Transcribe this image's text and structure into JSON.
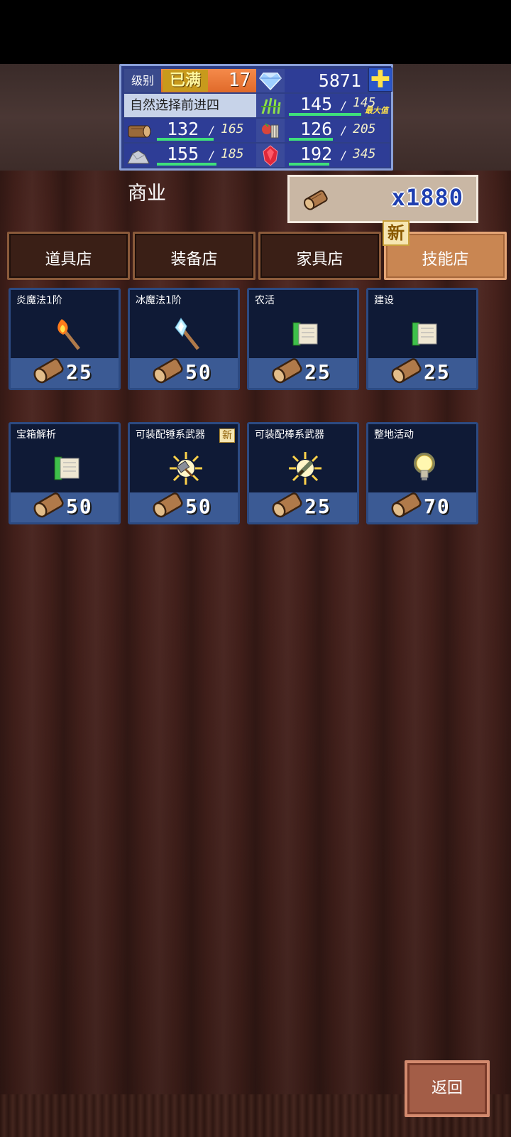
{
  "hud": {
    "level_label": "级别",
    "level_max": "已满",
    "level": "17",
    "gems": "5871",
    "title": "自然选择前进四",
    "plus_icon": "plus-icon",
    "grass": {
      "value": "145",
      "max": "145",
      "note": "最大值",
      "fill": 1.0
    },
    "wood": {
      "value": "132",
      "max": "165",
      "fill": 0.8
    },
    "food": {
      "value": "126",
      "max": "205",
      "fill": 0.61
    },
    "ore": {
      "value": "155",
      "max": "185",
      "fill": 0.84
    },
    "ruby": {
      "value": "192",
      "max": "345",
      "fill": 0.56
    }
  },
  "header": {
    "title": "商业",
    "currency": "x1880",
    "new_badge": "新"
  },
  "tabs": [
    {
      "label": "道具店",
      "active": false
    },
    {
      "label": "装备店",
      "active": false
    },
    {
      "label": "家具店",
      "active": false
    },
    {
      "label": "技能店",
      "active": true
    }
  ],
  "skills": [
    {
      "name": "炎魔法1阶",
      "icon": "fire-staff-icon",
      "price": "25"
    },
    {
      "name": "冰魔法1阶",
      "icon": "ice-staff-icon",
      "price": "50"
    },
    {
      "name": "农活",
      "icon": "scroll-icon",
      "price": "25"
    },
    {
      "name": "建设",
      "icon": "scroll-icon",
      "price": "25"
    },
    {
      "name": "宝箱解析",
      "icon": "scroll-icon",
      "price": "50"
    },
    {
      "name": "可装配锤系武器",
      "icon": "hammer-icon",
      "price": "50",
      "new": "新"
    },
    {
      "name": "可装配棒系武器",
      "icon": "club-icon",
      "price": "25"
    },
    {
      "name": "整地活动",
      "icon": "lightbulb-icon",
      "price": "70"
    }
  ],
  "back_label": "返回",
  "colors": {
    "accent_tab": "#c98652",
    "card_bg": "#0f1a36",
    "hud_bg": "#2f3f86",
    "price_text": "#ffffff"
  }
}
